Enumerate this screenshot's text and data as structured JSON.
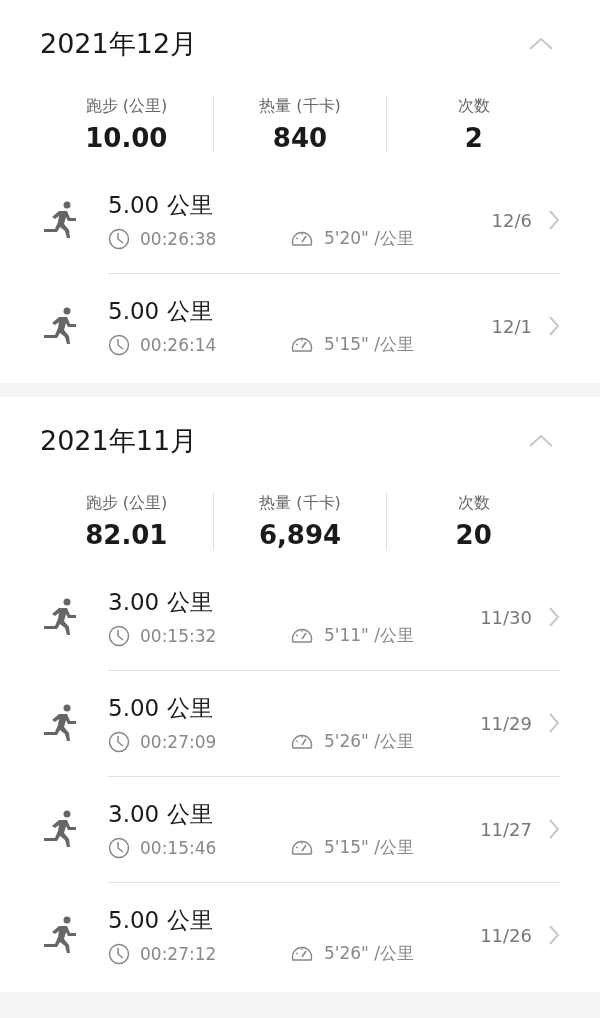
{
  "months": [
    {
      "title": "2021年12月",
      "expanded": true,
      "stats": [
        {
          "label": "跑步 (公里)",
          "value": "10.00"
        },
        {
          "label": "热量 (千卡)",
          "value": "840"
        },
        {
          "label": "次数",
          "value": "2"
        }
      ],
      "runs": [
        {
          "distance": "5.00 公里",
          "duration": "00:26:38",
          "pace": "5'20\" /公里",
          "date": "12/6"
        },
        {
          "distance": "5.00 公里",
          "duration": "00:26:14",
          "pace": "5'15\" /公里",
          "date": "12/1"
        }
      ]
    },
    {
      "title": "2021年11月",
      "expanded": true,
      "stats": [
        {
          "label": "跑步 (公里)",
          "value": "82.01"
        },
        {
          "label": "热量 (千卡)",
          "value": "6,894"
        },
        {
          "label": "次数",
          "value": "20"
        }
      ],
      "runs": [
        {
          "distance": "3.00 公里",
          "duration": "00:15:32",
          "pace": "5'11\" /公里",
          "date": "11/30"
        },
        {
          "distance": "5.00 公里",
          "duration": "00:27:09",
          "pace": "5'26\" /公里",
          "date": "11/29"
        },
        {
          "distance": "3.00 公里",
          "duration": "00:15:46",
          "pace": "5'15\" /公里",
          "date": "11/27"
        },
        {
          "distance": "5.00 公里",
          "duration": "00:27:12",
          "pace": "5'26\" /公里",
          "date": "11/26"
        }
      ]
    }
  ]
}
